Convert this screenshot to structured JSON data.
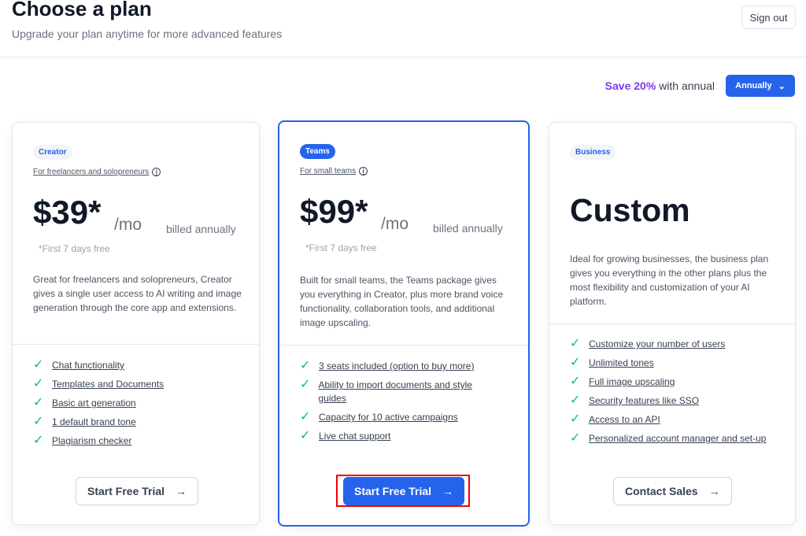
{
  "header": {
    "title": "Choose a plan",
    "subtitle": "Upgrade your plan anytime for more advanced features",
    "signout": "Sign out"
  },
  "billing": {
    "save": "Save 20%",
    "save_suffix": " with annual",
    "selected": "Annually",
    "accent": "#7c3aed"
  },
  "plans": [
    {
      "badge": "Creator",
      "for": "For freelancers and solopreneurs",
      "price": "$39*",
      "per": "/mo",
      "billed": "billed annually",
      "free": "*First 7 days free",
      "desc": "Great for freelancers and solopreneurs, Creator gives a single user access to AI writing and image generation through the core app and extensions.",
      "features": [
        "Chat functionality",
        "Templates and Documents",
        "Basic art generation",
        "1 default brand tone",
        "Plagiarism checker"
      ],
      "cta": "Start Free Trial"
    },
    {
      "badge": "Teams",
      "for": "For small teams",
      "price": "$99*",
      "per": "/mo",
      "billed": "billed annually",
      "free": "*First 7 days free",
      "desc": "Built for small teams, the Teams package gives you everything in Creator, plus more brand voice functionality, collaboration tools, and additional image upscaling.",
      "features": [
        "3 seats included (option to buy more)",
        "Ability to import documents and style guides",
        "Capacity for 10 active campaigns",
        "Live chat support"
      ],
      "cta": "Start Free Trial"
    },
    {
      "badge": "Business",
      "price": "Custom",
      "desc": "Ideal for growing businesses, the business plan gives you everything in the other plans plus the most flexibility and customization of your AI platform.",
      "features": [
        "Customize your number of users",
        "Unlimited tones",
        "Full image upscaling",
        "Security features like SSO",
        "Access to an API",
        "Personalized account manager and set-up"
      ],
      "cta": "Contact Sales"
    }
  ],
  "colors": {
    "primary": "#2563eb",
    "check": "#10b981"
  }
}
